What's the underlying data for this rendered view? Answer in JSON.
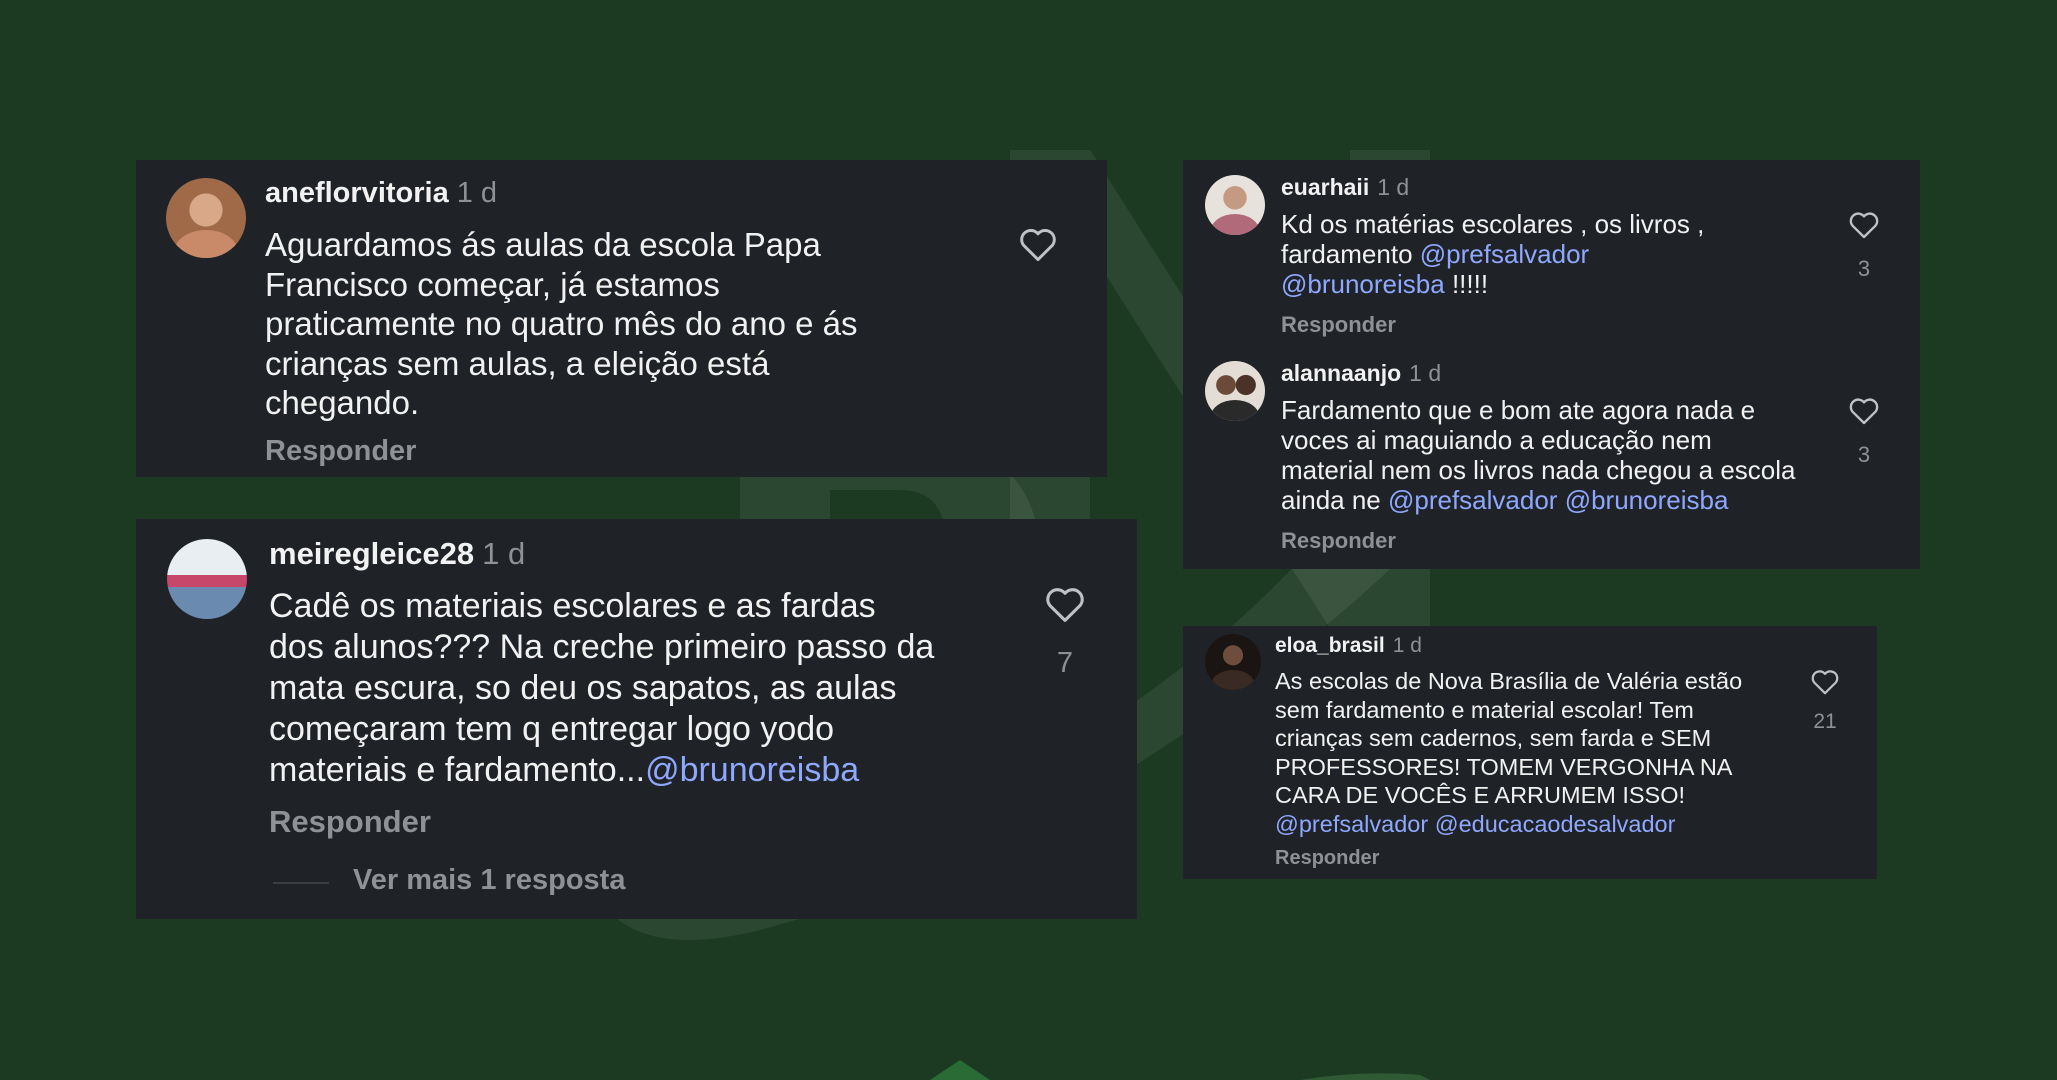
{
  "comments": [
    {
      "username": "aneflorvitoria",
      "time": "1 d",
      "lines": [
        [
          {
            "t": "Aguardamos ás aulas da escola Papa"
          }
        ],
        [
          {
            "t": "Francisco começar, já estamos"
          }
        ],
        [
          {
            "t": "praticamente no quatro mês do ano e ás"
          }
        ],
        [
          {
            "t": "crianças sem aulas, a eleição está"
          }
        ],
        [
          {
            "t": "chegando."
          }
        ]
      ],
      "reply": "Responder",
      "likes": ""
    },
    {
      "username": "meiregleice28",
      "time": "1 d",
      "lines": [
        [
          {
            "t": "Cadê  os materiais escolares e as fardas"
          }
        ],
        [
          {
            "t": "dos alunos??? Na creche primeiro passo da"
          }
        ],
        [
          {
            "t": "mata escura, so deu os sapatos, as aulas"
          }
        ],
        [
          {
            "t": "começaram tem q entregar logo yodo"
          }
        ],
        [
          {
            "t": "materiais e fardamento..."
          },
          {
            "t": "@brunoreisba",
            "m": true
          }
        ]
      ],
      "reply": "Responder",
      "likes": "7",
      "more_replies": "Ver mais 1 resposta"
    },
    {
      "username": "euarhaii",
      "time": "1 d",
      "lines": [
        [
          {
            "t": "Kd os matérias escolares , os livros ,"
          }
        ],
        [
          {
            "t": "fardamento "
          },
          {
            "t": "@prefsalvador",
            "m": true
          }
        ],
        [
          {
            "t": "@brunoreisba",
            "m": true
          },
          {
            "t": " !!!!!"
          }
        ]
      ],
      "reply": "Responder",
      "likes": "3"
    },
    {
      "username": "alannaanjo",
      "time": "1 d",
      "lines": [
        [
          {
            "t": "Fardamento que e bom ate agora nada e"
          }
        ],
        [
          {
            "t": "voces ai maguiando a educação nem"
          }
        ],
        [
          {
            "t": "material nem os livros nada chegou a escola"
          }
        ],
        [
          {
            "t": "ainda ne "
          },
          {
            "t": "@prefsalvador",
            "m": true
          },
          {
            "t": "  "
          },
          {
            "t": "@brunoreisba",
            "m": true
          }
        ]
      ],
      "reply": "Responder",
      "likes": "3"
    },
    {
      "username": "eloa_brasil",
      "time": "1 d",
      "lines": [
        [
          {
            "t": "As escolas de Nova Brasília de Valéria estão"
          }
        ],
        [
          {
            "t": "sem fardamento e material escolar! Tem"
          }
        ],
        [
          {
            "t": "crianças sem cadernos, sem farda e SEM"
          }
        ],
        [
          {
            "t": "PROFESSORES! TOMEM VERGONHA NA"
          }
        ],
        [
          {
            "t": "CARA DE VOCÊS E ARRUMEM ISSO!"
          }
        ],
        [
          {
            "t": "@prefsalvador",
            "m": true
          },
          {
            "t": " "
          },
          {
            "t": "@educacaodesalvador",
            "m": true
          }
        ]
      ],
      "reply": "Responder",
      "likes": "21"
    }
  ],
  "colors": {
    "background": "#1c3a22",
    "card": "#1f2226",
    "mention": "#8fa8ff",
    "muted": "#8e9196"
  }
}
